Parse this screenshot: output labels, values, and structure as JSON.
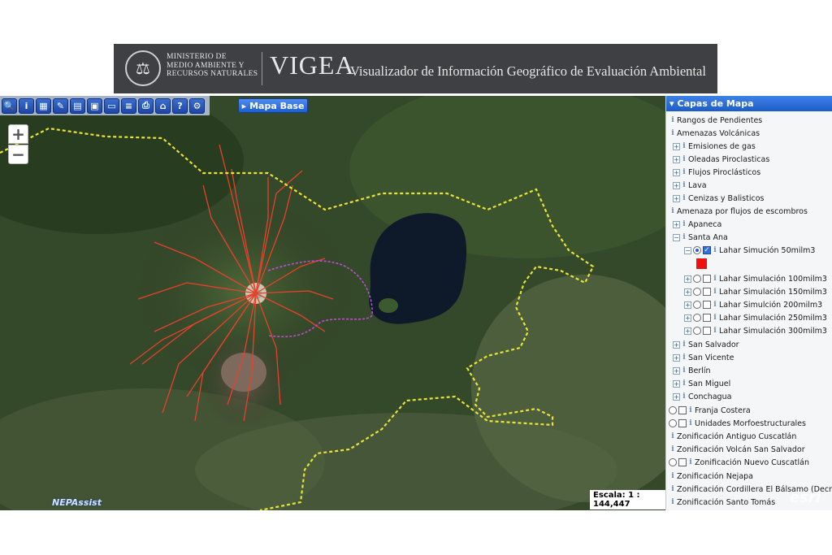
{
  "banner": {
    "ministry": "MINISTERIO DE\nMEDIO AMBIENTE Y\nRECURSOS NATURALES",
    "app_name": "VIGEA",
    "subtitle": "Visualizador de Información Geográfico de Evaluación Ambiental"
  },
  "toolbar": {
    "tools": [
      "search-icon",
      "info-icon",
      "legend-icon",
      "edit-icon",
      "save-icon",
      "print-preview-icon",
      "measure-icon",
      "layers-icon",
      "print-icon",
      "home-icon",
      "help-icon",
      "settings-icon"
    ],
    "basemap_label": "Mapa Base"
  },
  "map": {
    "zoom_in": "+",
    "zoom_out": "−",
    "attribution": "NEPAssist",
    "scale": "Escala: 1 : 144,447",
    "esri": "esri"
  },
  "panel": {
    "title": "Capas de Mapa",
    "layers": [
      "Rangos de Pendientes",
      "Amenazas Volcánicas",
      "Emisiones de gas",
      "Oleadas Piroclasticas",
      "Flujos Piroclásticos",
      "Lava",
      "Cenizas y Balisticos",
      "Amenaza por flujos de escombros",
      "Apaneca",
      "Santa Ana",
      "Lahar Simución 50milm3",
      "Lahar Simulación 100milm3",
      "Lahar Simulación 150milm3",
      "Lahar Simulción 200milm3",
      "Lahar Simulación 250milm3",
      "Lahar Simulación 300milm3",
      "San Salvador",
      "San Vicente",
      "Berlín",
      "San Miguel",
      "Conchagua",
      "Franja Costera",
      "Unidades Morfoestructurales",
      "Zonificación Antiguo Cuscatlán",
      "Zonificación Volcán San Salvador",
      "Zonificación Nuevo Cuscatlán",
      "Zonificación Nejapa",
      "Zonificación Cordillera El Bálsamo (Decreto",
      "Zonificación Santo Tomás"
    ]
  },
  "colors": {
    "lahar_swatch": "#ee1111",
    "boundary": "#e8e23a",
    "lahar_paths": "#e8412a",
    "purple_zone": "#c04bd6"
  }
}
